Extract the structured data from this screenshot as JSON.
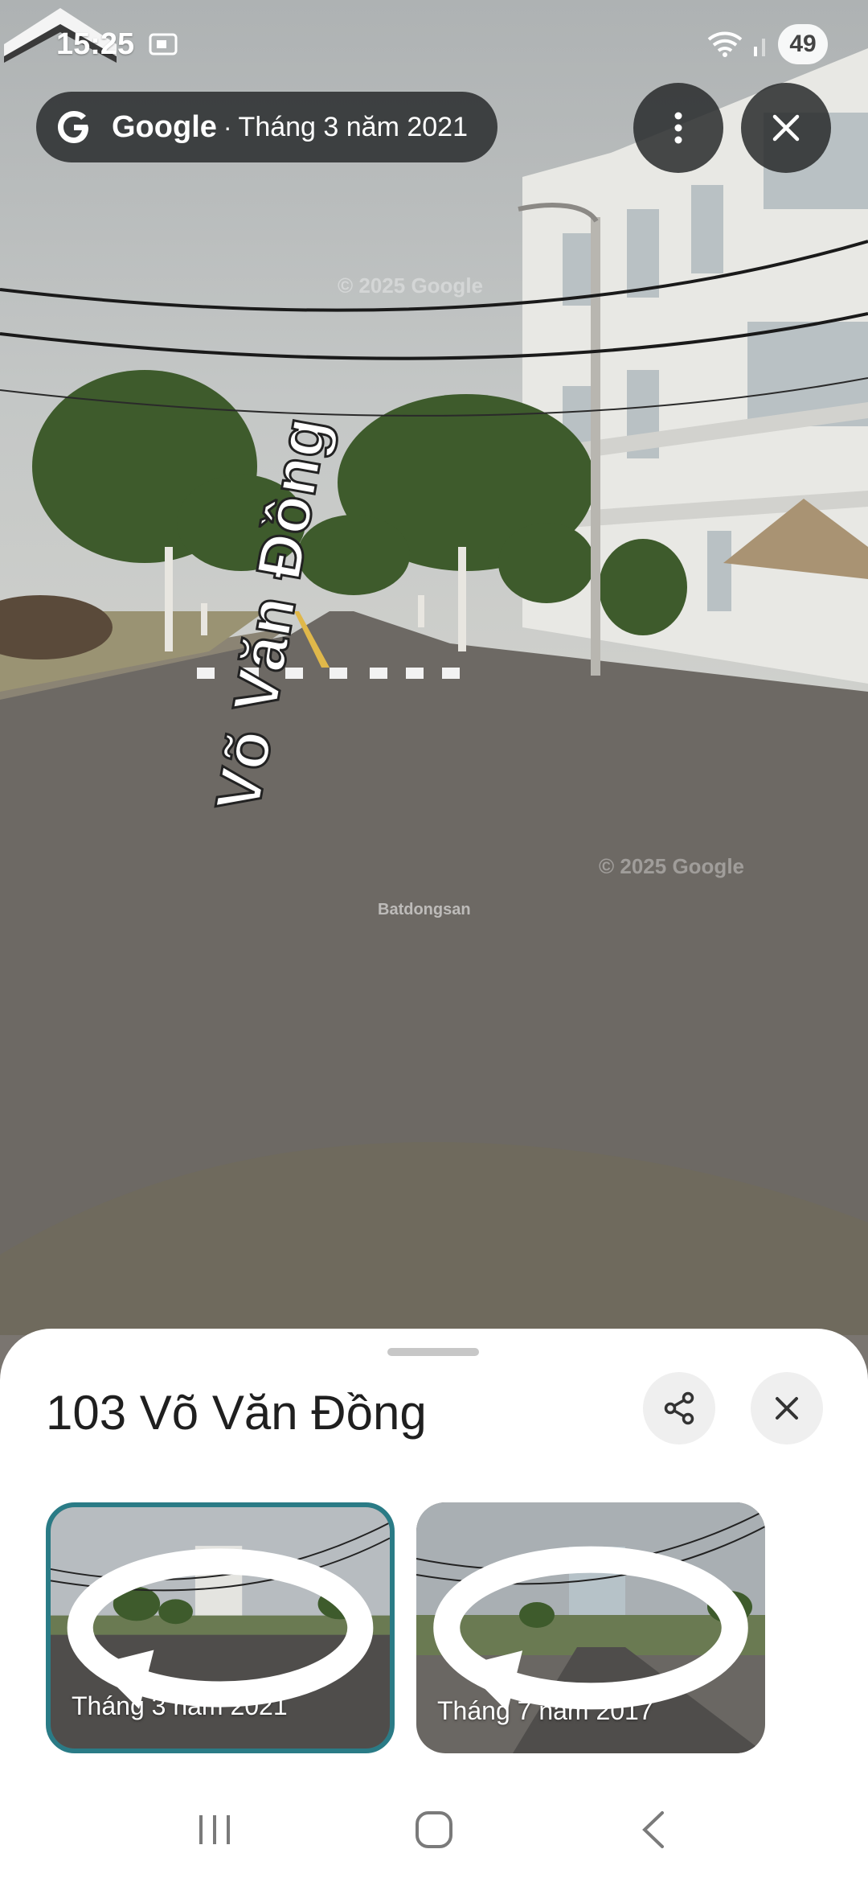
{
  "status_bar": {
    "time": "15:25",
    "battery_level": "49"
  },
  "top_chip": {
    "brand": "Google",
    "separator": "·",
    "date": "Tháng 3 năm 2021"
  },
  "scene": {
    "street_name": "Võ Văn Đồng",
    "watermark": "© 2025 Google",
    "overlay_watermark": "Batdongsan"
  },
  "sheet": {
    "address": "103 Võ Văn Đồng",
    "thumbnails": [
      {
        "label": "Tháng 3 năm 2021",
        "selected": true
      },
      {
        "label": "Tháng 7 năm 2017",
        "selected": false
      }
    ]
  },
  "colors": {
    "selected_border": "#2a7b86",
    "chip_bg": "#282a2c"
  },
  "icons": [
    "cast-icon",
    "wifi-icon",
    "signal-icon",
    "google-g-icon",
    "more-vert-icon",
    "close-icon",
    "share-icon",
    "rotate-360-icon",
    "recents-icon",
    "home-icon",
    "back-icon"
  ]
}
